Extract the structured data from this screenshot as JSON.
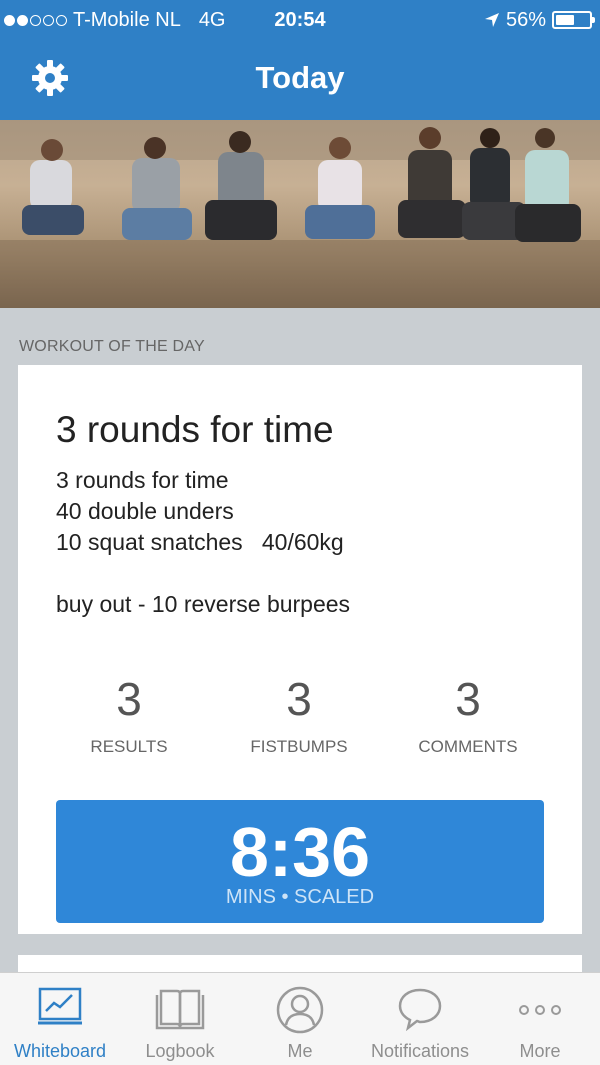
{
  "status": {
    "dots": [
      true,
      true,
      false,
      false,
      false
    ],
    "carrier": "T-Mobile NL",
    "network": "4G",
    "time": "20:54",
    "battery_percent": "56%",
    "battery_level": 0.56
  },
  "header": {
    "title": "Today",
    "settings_icon": "gear-icon"
  },
  "section": {
    "label": "WORKOUT OF THE DAY"
  },
  "workout": {
    "title": "3 rounds for time",
    "description": "3 rounds for time\n40 double unders\n10 squat snatches   40/60kg\n\nbuy out - 10 reverse burpees",
    "stats": [
      {
        "value": "3",
        "label": "RESULTS"
      },
      {
        "value": "3",
        "label": "FISTBUMPS"
      },
      {
        "value": "3",
        "label": "COMMENTS"
      }
    ],
    "score": {
      "value": "8:36",
      "detail": "MINS • SCALED"
    }
  },
  "tabs": [
    {
      "label": "Whiteboard",
      "icon": "whiteboard-icon",
      "active": true
    },
    {
      "label": "Logbook",
      "icon": "book-icon",
      "active": false
    },
    {
      "label": "Me",
      "icon": "person-icon",
      "active": false
    },
    {
      "label": "Notifications",
      "icon": "chat-bubble-icon",
      "active": false
    },
    {
      "label": "More",
      "icon": "more-icon",
      "active": false
    }
  ],
  "colors": {
    "header": "#2f80c6",
    "score_button": "#2f87d8",
    "background": "#c9ced2",
    "tab_active": "#2f80c6"
  }
}
